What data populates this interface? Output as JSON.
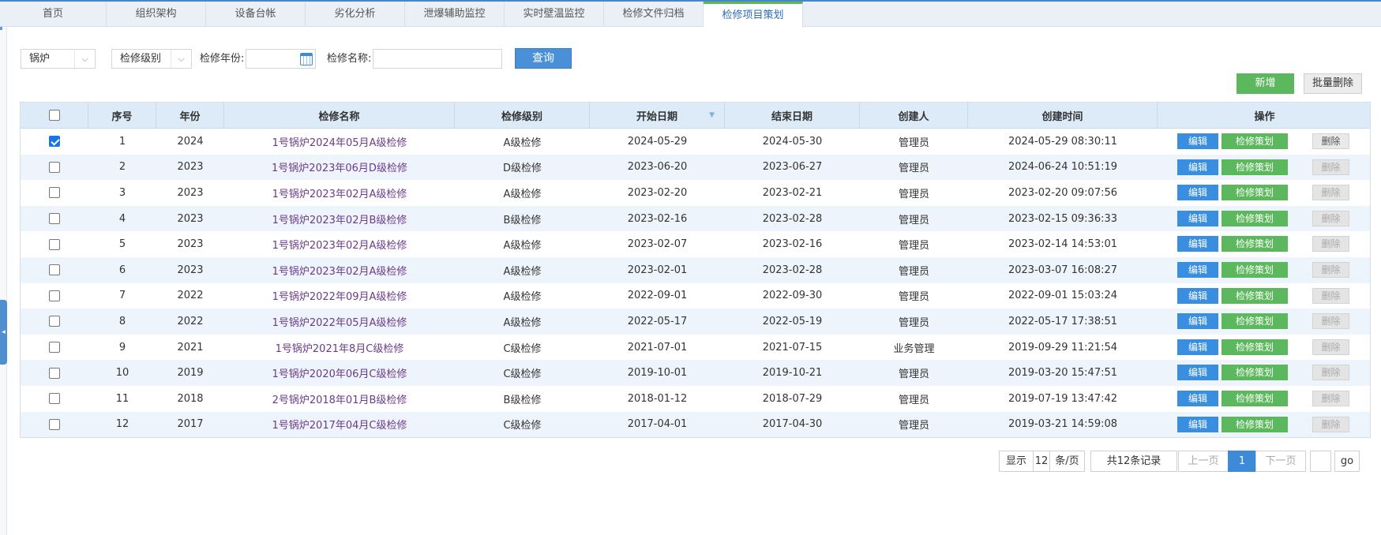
{
  "tabs": [
    "首页",
    "组织架构",
    "设备台帐",
    "劣化分析",
    "泄爆辅助监控",
    "实时壁温监控",
    "检修文件归档",
    "检修项目策划"
  ],
  "active_tab": "检修项目策划",
  "filters": {
    "equipment_value": "锅炉",
    "level_value": "检修级别",
    "year_label": "检修年份:",
    "year_value": "",
    "name_label": "检修名称:",
    "name_value": "",
    "query_label": "查询"
  },
  "toolbar": {
    "add_label": "新增",
    "batch_delete_label": "批量删除"
  },
  "table": {
    "columns": [
      "序号",
      "年份",
      "检修名称",
      "检修级别",
      "开始日期",
      "结束日期",
      "创建人",
      "创建时间",
      "操作"
    ],
    "action_labels": {
      "edit": "编辑",
      "plan": "检修策划",
      "delete": "删除"
    },
    "rows": [
      {
        "no": "1",
        "year": "2024",
        "name": "1号锅炉2024年05月A级检修",
        "level": "A级检修",
        "start": "2024-05-29",
        "end": "2024-05-30",
        "creator": "管理员",
        "created": "2024-05-29 08:30:11",
        "checked": true
      },
      {
        "no": "2",
        "year": "2023",
        "name": "1号锅炉2023年06月D级检修",
        "level": "D级检修",
        "start": "2023-06-20",
        "end": "2023-06-27",
        "creator": "管理员",
        "created": "2024-06-24 10:51:19",
        "checked": false
      },
      {
        "no": "3",
        "year": "2023",
        "name": "1号锅炉2023年02月A级检修",
        "level": "A级检修",
        "start": "2023-02-20",
        "end": "2023-02-21",
        "creator": "管理员",
        "created": "2023-02-20 09:07:56",
        "checked": false
      },
      {
        "no": "4",
        "year": "2023",
        "name": "1号锅炉2023年02月B级检修",
        "level": "B级检修",
        "start": "2023-02-16",
        "end": "2023-02-28",
        "creator": "管理员",
        "created": "2023-02-15 09:36:33",
        "checked": false
      },
      {
        "no": "5",
        "year": "2023",
        "name": "1号锅炉2023年02月A级检修",
        "level": "A级检修",
        "start": "2023-02-07",
        "end": "2023-02-16",
        "creator": "管理员",
        "created": "2023-02-14 14:53:01",
        "checked": false
      },
      {
        "no": "6",
        "year": "2023",
        "name": "1号锅炉2023年02月A级检修",
        "level": "A级检修",
        "start": "2023-02-01",
        "end": "2023-02-28",
        "creator": "管理员",
        "created": "2023-03-07 16:08:27",
        "checked": false
      },
      {
        "no": "7",
        "year": "2022",
        "name": "1号锅炉2022年09月A级检修",
        "level": "A级检修",
        "start": "2022-09-01",
        "end": "2022-09-30",
        "creator": "管理员",
        "created": "2022-09-01 15:03:24",
        "checked": false
      },
      {
        "no": "8",
        "year": "2022",
        "name": "1号锅炉2022年05月A级检修",
        "level": "A级检修",
        "start": "2022-05-17",
        "end": "2022-05-19",
        "creator": "管理员",
        "created": "2022-05-17 17:38:51",
        "checked": false
      },
      {
        "no": "9",
        "year": "2021",
        "name": "1号锅炉2021年8月C级检修",
        "level": "C级检修",
        "start": "2021-07-01",
        "end": "2021-07-15",
        "creator": "业务管理",
        "created": "2019-09-29 11:21:54",
        "checked": false
      },
      {
        "no": "10",
        "year": "2019",
        "name": "1号锅炉2020年06月C级检修",
        "level": "C级检修",
        "start": "2019-10-01",
        "end": "2019-10-21",
        "creator": "管理员",
        "created": "2019-03-20 15:47:51",
        "checked": false
      },
      {
        "no": "11",
        "year": "2018",
        "name": "2号锅炉2018年01月B级检修",
        "level": "B级检修",
        "start": "2018-01-12",
        "end": "2018-07-29",
        "creator": "管理员",
        "created": "2019-07-19 13:47:42",
        "checked": false
      },
      {
        "no": "12",
        "year": "2017",
        "name": "1号锅炉2017年04月C级检修",
        "level": "C级检修",
        "start": "2017-04-01",
        "end": "2017-04-30",
        "creator": "管理员",
        "created": "2019-03-21 14:59:08",
        "checked": false
      }
    ]
  },
  "pagination": {
    "show_label": "显示",
    "page_size": "12",
    "per_page_label": "条/页",
    "total_label": "共12条记录",
    "prev_label": "上一页",
    "current_page": "1",
    "next_label": "下一页",
    "jump_value": "",
    "go_label": "go"
  },
  "colors": {
    "primary": "#4a90d9",
    "success": "#5cb85c",
    "header_bg": "#ddeaf7",
    "row_alt": "#eef4fb",
    "name_text": "#6b3a8a"
  }
}
